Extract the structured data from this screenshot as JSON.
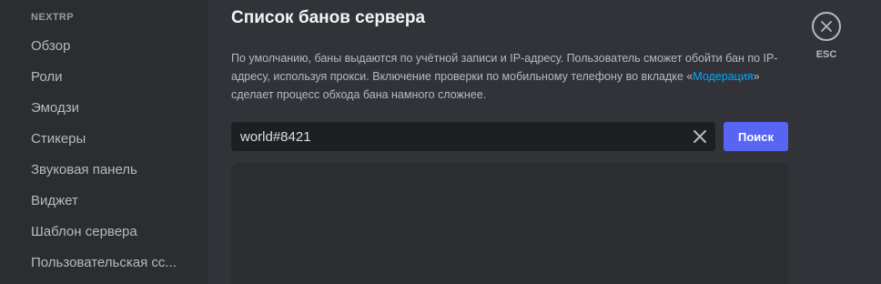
{
  "sidebar": {
    "server_name": "NEXTRP",
    "items": [
      {
        "label": "Обзор"
      },
      {
        "label": "Роли"
      },
      {
        "label": "Эмодзи"
      },
      {
        "label": "Стикеры"
      },
      {
        "label": "Звуковая панель"
      },
      {
        "label": "Виджет"
      },
      {
        "label": "Шаблон сервера"
      },
      {
        "label": "Пользовательская сс..."
      }
    ]
  },
  "main": {
    "title": "Список банов сервера",
    "description_part1": "По умолчанию, баны выдаются по учётной записи и IP-адресу. Пользователь сможет обойти бан по IP-адресу, используя прокси. Включение проверки по мобильному телефону во вкладке «",
    "description_link": "Модерация",
    "description_part2": "» сделает процесс обхода бана намного сложнее.",
    "search": {
      "value": "world#8421",
      "button_label": "Поиск"
    }
  },
  "close": {
    "label": "ESC",
    "icon": "close-icon"
  },
  "colors": {
    "accent": "#5865f2",
    "link": "#00a8fc",
    "sidebar_bg": "#2b2d31",
    "main_bg": "#313338"
  }
}
